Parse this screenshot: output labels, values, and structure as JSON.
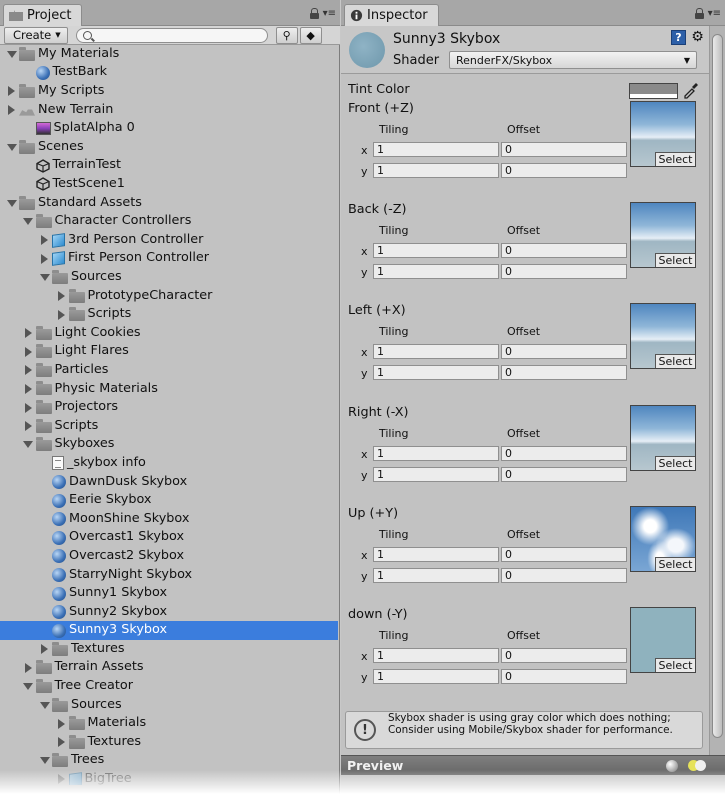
{
  "project": {
    "tab_label": "Project",
    "create_label": "Create",
    "search_placeholder": "",
    "tree": [
      {
        "label": "My Materials",
        "depth": 0,
        "arrow": "down",
        "icon": "folder"
      },
      {
        "label": "TestBark",
        "depth": 1,
        "arrow": "none",
        "icon": "sphere"
      },
      {
        "label": "My Scripts",
        "depth": 0,
        "arrow": "right",
        "icon": "folder"
      },
      {
        "label": "New Terrain",
        "depth": 0,
        "arrow": "right",
        "icon": "terrain"
      },
      {
        "label": "SplatAlpha 0",
        "depth": 1,
        "arrow": "none",
        "icon": "texture"
      },
      {
        "label": "Scenes",
        "depth": 0,
        "arrow": "down",
        "icon": "folder"
      },
      {
        "label": "TerrainTest",
        "depth": 1,
        "arrow": "none",
        "icon": "unity"
      },
      {
        "label": "TestScene1",
        "depth": 1,
        "arrow": "none",
        "icon": "unity"
      },
      {
        "label": "Standard Assets",
        "depth": 0,
        "arrow": "down",
        "icon": "folder"
      },
      {
        "label": "Character Controllers",
        "depth": 1,
        "arrow": "down",
        "icon": "folder"
      },
      {
        "label": "3rd Person Controller",
        "depth": 2,
        "arrow": "right",
        "icon": "cube"
      },
      {
        "label": "First Person Controller",
        "depth": 2,
        "arrow": "right",
        "icon": "cube"
      },
      {
        "label": "Sources",
        "depth": 2,
        "arrow": "down",
        "icon": "folder"
      },
      {
        "label": "PrototypeCharacter",
        "depth": 3,
        "arrow": "right",
        "icon": "folder"
      },
      {
        "label": "Scripts",
        "depth": 3,
        "arrow": "right",
        "icon": "folder"
      },
      {
        "label": "Light Cookies",
        "depth": 1,
        "arrow": "right",
        "icon": "folder"
      },
      {
        "label": "Light Flares",
        "depth": 1,
        "arrow": "right",
        "icon": "folder"
      },
      {
        "label": "Particles",
        "depth": 1,
        "arrow": "right",
        "icon": "folder"
      },
      {
        "label": "Physic Materials",
        "depth": 1,
        "arrow": "right",
        "icon": "folder"
      },
      {
        "label": "Projectors",
        "depth": 1,
        "arrow": "right",
        "icon": "folder"
      },
      {
        "label": "Scripts",
        "depth": 1,
        "arrow": "right",
        "icon": "folder"
      },
      {
        "label": "Skyboxes",
        "depth": 1,
        "arrow": "down",
        "icon": "folder"
      },
      {
        "label": "_skybox info",
        "depth": 2,
        "arrow": "none",
        "icon": "text"
      },
      {
        "label": "DawnDusk Skybox",
        "depth": 2,
        "arrow": "none",
        "icon": "sphere"
      },
      {
        "label": "Eerie Skybox",
        "depth": 2,
        "arrow": "none",
        "icon": "sphere"
      },
      {
        "label": "MoonShine Skybox",
        "depth": 2,
        "arrow": "none",
        "icon": "sphere"
      },
      {
        "label": "Overcast1 Skybox",
        "depth": 2,
        "arrow": "none",
        "icon": "sphere"
      },
      {
        "label": "Overcast2 Skybox",
        "depth": 2,
        "arrow": "none",
        "icon": "sphere"
      },
      {
        "label": "StarryNight Skybox",
        "depth": 2,
        "arrow": "none",
        "icon": "sphere"
      },
      {
        "label": "Sunny1 Skybox",
        "depth": 2,
        "arrow": "none",
        "icon": "sphere"
      },
      {
        "label": "Sunny2 Skybox",
        "depth": 2,
        "arrow": "none",
        "icon": "sphere"
      },
      {
        "label": "Sunny3 Skybox",
        "depth": 2,
        "arrow": "none",
        "icon": "sphere",
        "selected": true
      },
      {
        "label": "Textures",
        "depth": 2,
        "arrow": "right",
        "icon": "folder"
      },
      {
        "label": "Terrain Assets",
        "depth": 1,
        "arrow": "right",
        "icon": "folder"
      },
      {
        "label": "Tree Creator",
        "depth": 1,
        "arrow": "down",
        "icon": "folder"
      },
      {
        "label": "Sources",
        "depth": 2,
        "arrow": "down",
        "icon": "folder"
      },
      {
        "label": "Materials",
        "depth": 3,
        "arrow": "right",
        "icon": "folder"
      },
      {
        "label": "Textures",
        "depth": 3,
        "arrow": "right",
        "icon": "folder"
      },
      {
        "label": "Trees",
        "depth": 2,
        "arrow": "down",
        "icon": "folder"
      },
      {
        "label": "BigTree",
        "depth": 3,
        "arrow": "right",
        "icon": "cube"
      }
    ]
  },
  "inspector": {
    "tab_label": "Inspector",
    "material_name": "Sunny3 Skybox",
    "shader_label": "Shader",
    "shader_value": "RenderFX/Skybox",
    "help_icon_text": "?",
    "tint_label": "Tint Color",
    "tiling_label": "Tiling",
    "offset_label": "Offset",
    "x_label": "x",
    "y_label": "y",
    "select_label": "Select",
    "textures": [
      {
        "label": "Front (+Z)",
        "tile_x": "1",
        "tile_y": "1",
        "off_x": "0",
        "off_y": "0",
        "sky": "horizon"
      },
      {
        "label": "Back (-Z)",
        "tile_x": "1",
        "tile_y": "1",
        "off_x": "0",
        "off_y": "0",
        "sky": "horizon"
      },
      {
        "label": "Left (+X)",
        "tile_x": "1",
        "tile_y": "1",
        "off_x": "0",
        "off_y": "0",
        "sky": "horizon"
      },
      {
        "label": "Right (-X)",
        "tile_x": "1",
        "tile_y": "1",
        "off_x": "0",
        "off_y": "0",
        "sky": "horizon"
      },
      {
        "label": "Up (+Y)",
        "tile_x": "1",
        "tile_y": "1",
        "off_x": "0",
        "off_y": "0",
        "sky": "clouds"
      },
      {
        "label": "down (-Y)",
        "tile_x": "1",
        "tile_y": "1",
        "off_x": "0",
        "off_y": "0",
        "sky": "flat"
      }
    ],
    "help_message": "Skybox shader is using gray color which does nothing; Consider using Mobile/Skybox shader for performance.",
    "preview_label": "Preview",
    "info_icon_text": "!"
  },
  "colors": {
    "selection": "#3b7ddd",
    "panel_bg": "#c2c2c2",
    "tint": "#8a8a8a",
    "down_texture": "#8fb2be"
  }
}
